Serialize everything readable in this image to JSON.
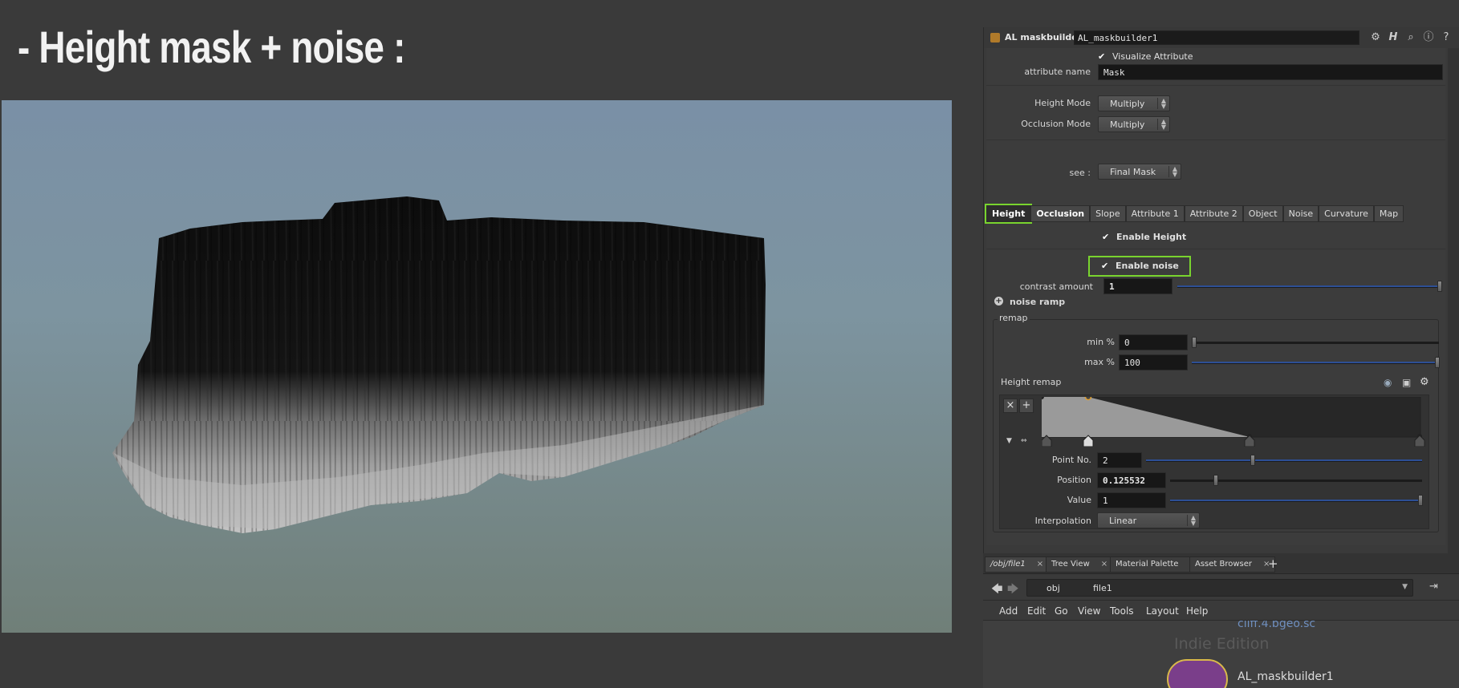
{
  "slide": {
    "title": "-  Height mask + noise :"
  },
  "panel": {
    "node_type": "AL maskbuilder",
    "node_name": "AL_maskbuilder1",
    "visualize_attribute": "Visualize Attribute",
    "attribute_name_label": "attribute name",
    "attribute_name_value": "Mask",
    "height_mode_label": "Height Mode",
    "height_mode_value": "Multiply",
    "occlusion_mode_label": "Occlusion Mode",
    "occlusion_mode_value": "Multiply",
    "see_label": "see :",
    "see_value": "Final Mask",
    "tabs": [
      "Height",
      "Occlusion",
      "Slope",
      "Attribute 1",
      "Attribute 2",
      "Object",
      "Noise",
      "Curvature",
      "Map"
    ],
    "enable_height": "Enable Height",
    "enable_noise": "Enable noise",
    "contrast_label": "contrast amount",
    "contrast_value": "1",
    "noise_ramp": "noise ramp",
    "remap_label": "remap",
    "min_label": "min %",
    "min_value": "0",
    "max_label": "max %",
    "max_value": "100",
    "height_remap": "Height remap",
    "point_no_label": "Point No.",
    "point_no_value": "2",
    "position_label": "Position",
    "position_value": "0.125532",
    "value_label": "Value",
    "value_value": "1",
    "interp_label": "Interpolation",
    "interp_value": "Linear"
  },
  "bottom": {
    "tabs": [
      "/obj/file1",
      "Tree View",
      "Material Palette",
      "Asset Browser"
    ],
    "path": [
      "obj",
      "file1"
    ],
    "menu": [
      "Add",
      "Edit",
      "Go",
      "View",
      "Tools",
      "Layout",
      "Help"
    ],
    "net_file": "cliff.4.bgeo.sc",
    "watermark": "Indie Edition",
    "node_label": "AL_maskbuilder1"
  },
  "colors": {
    "highlight": "#79d42e",
    "slider_blue": "#2d4f95"
  },
  "icons": [
    "node-icon",
    "gear-icon",
    "help-icon",
    "search-icon",
    "info-icon",
    "back-arrow-icon",
    "forward-arrow-icon",
    "pin-icon",
    "close-icon",
    "plus-icon"
  ]
}
